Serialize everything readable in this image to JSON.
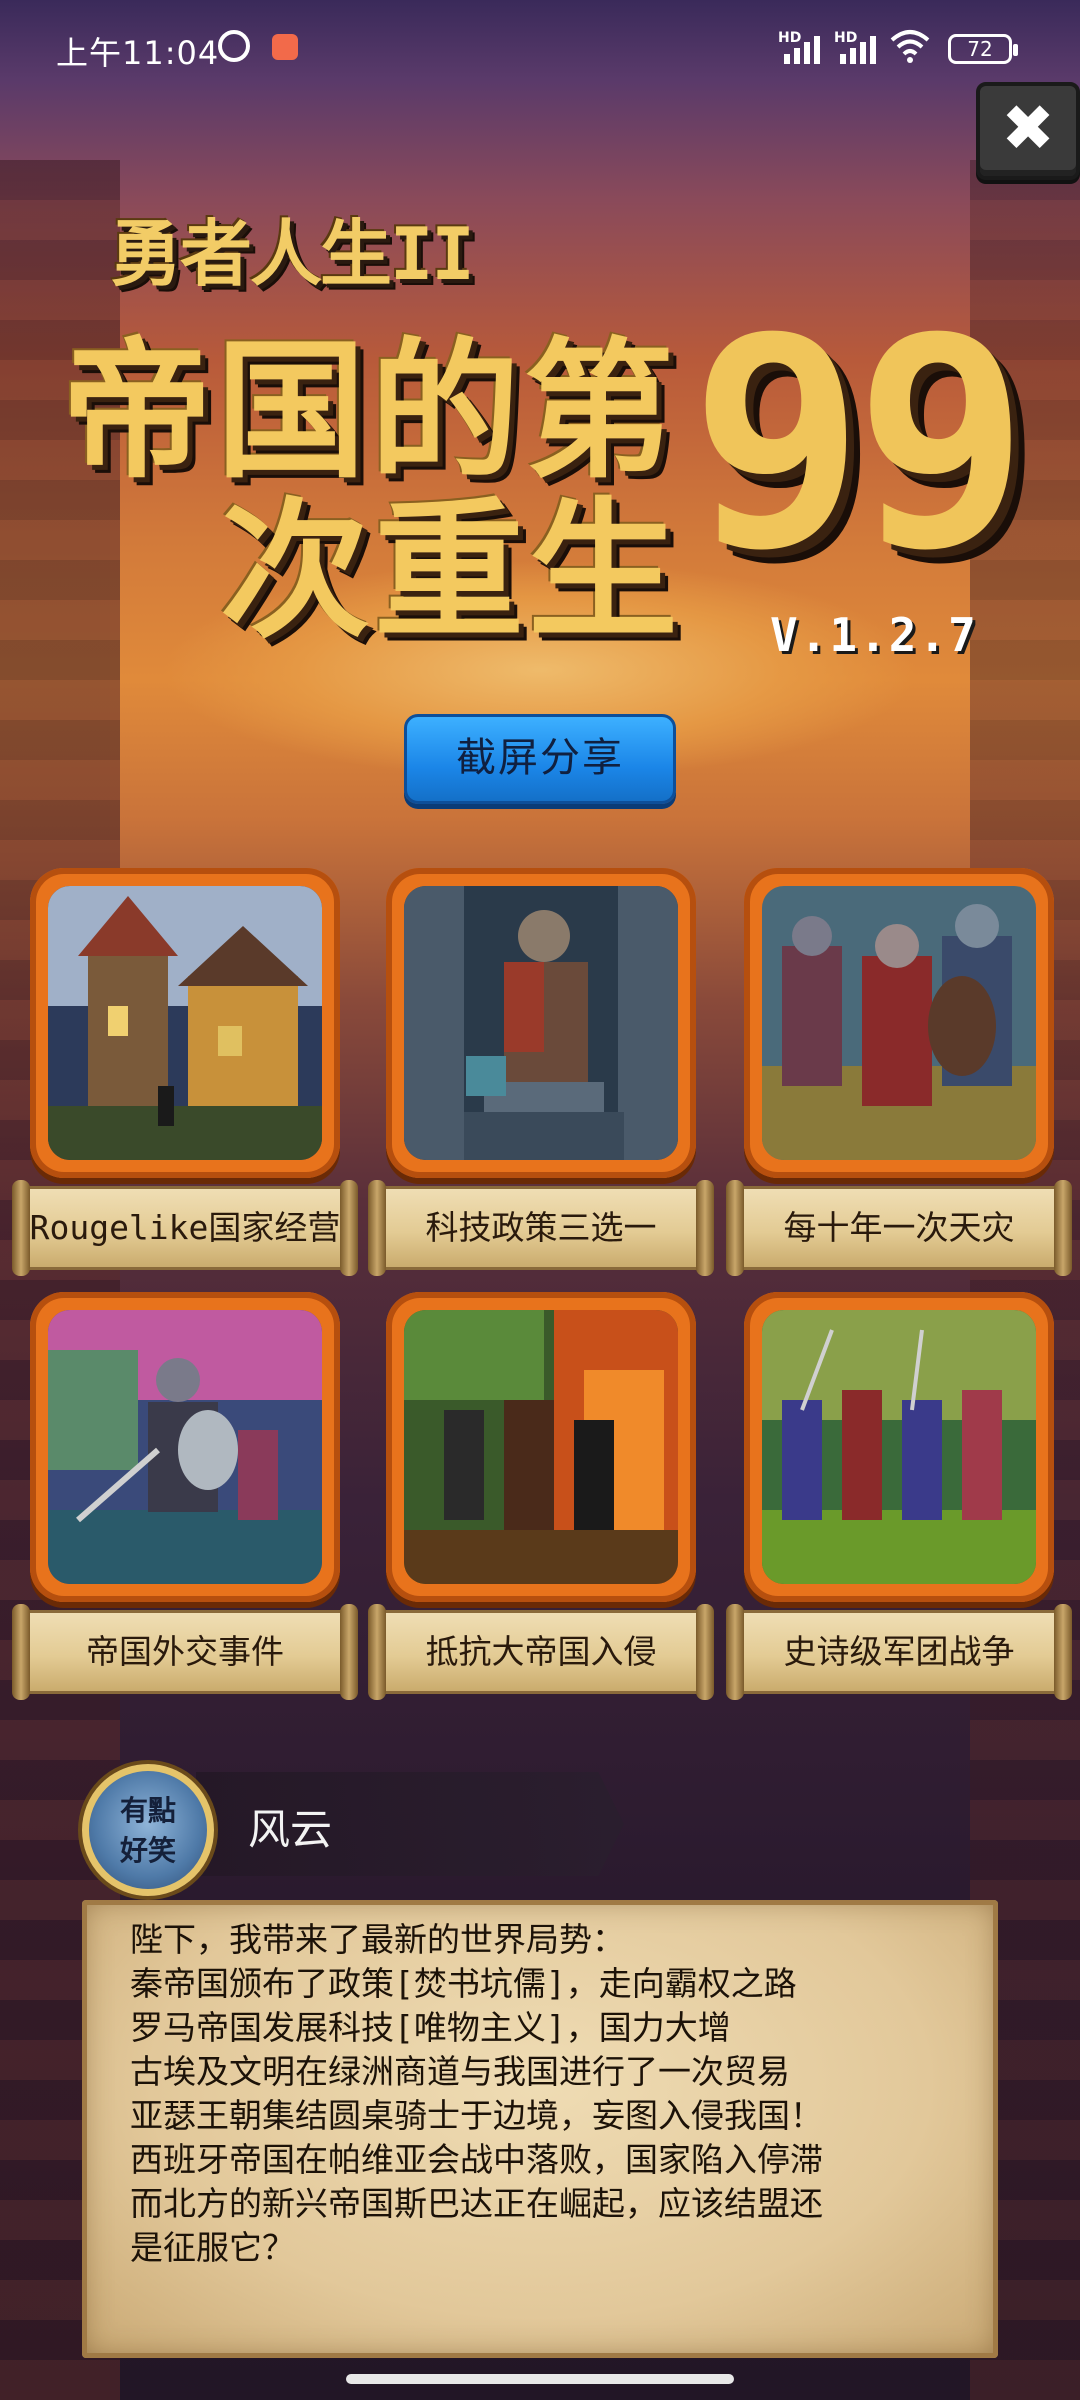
{
  "status_bar": {
    "time": "上午11:04",
    "signal1_label": "HD",
    "signal2_label": "HD",
    "battery": "72"
  },
  "close_button": {
    "icon": "close-x-icon",
    "glyph": "✖"
  },
  "title": {
    "subtitle": "勇者人生II",
    "line1": "帝国的第",
    "line2": "次重生",
    "number": "99",
    "version": "V.1.2.7"
  },
  "share_button": {
    "label": "截屏分享"
  },
  "features": [
    {
      "label": "Rougelike国家经营",
      "image": "pixel-art-town"
    },
    {
      "label": "科技政策三选一",
      "image": "pixel-art-statue"
    },
    {
      "label": "每十年一次天灾",
      "image": "pixel-art-knights"
    },
    {
      "label": "帝国外交事件",
      "image": "pixel-art-warrior"
    },
    {
      "label": "抵抗大帝国入侵",
      "image": "pixel-art-battle-fire"
    },
    {
      "label": "史诗级军团战争",
      "image": "pixel-art-army"
    }
  ],
  "advisor": {
    "badge_line1": "有點",
    "badge_line2": "好笑",
    "name": "风云"
  },
  "message": {
    "lines": [
      "陛下，我带来了最新的世界局势：",
      "秦帝国颁布了政策[焚书坑儒]，走向霸权之路",
      "罗马帝国发展科技[唯物主义]，国力大增",
      "古埃及文明在绿洲商道与我国进行了一次贸易",
      "亚瑟王朝集结圆桌骑士于边境，妄图入侵我国！",
      "西班牙帝国在帕维亚会战中落败，国家陷入停滞",
      "而北方的新兴帝国斯巴达正在崛起，应该结盟还",
      "是征服它？"
    ]
  }
}
